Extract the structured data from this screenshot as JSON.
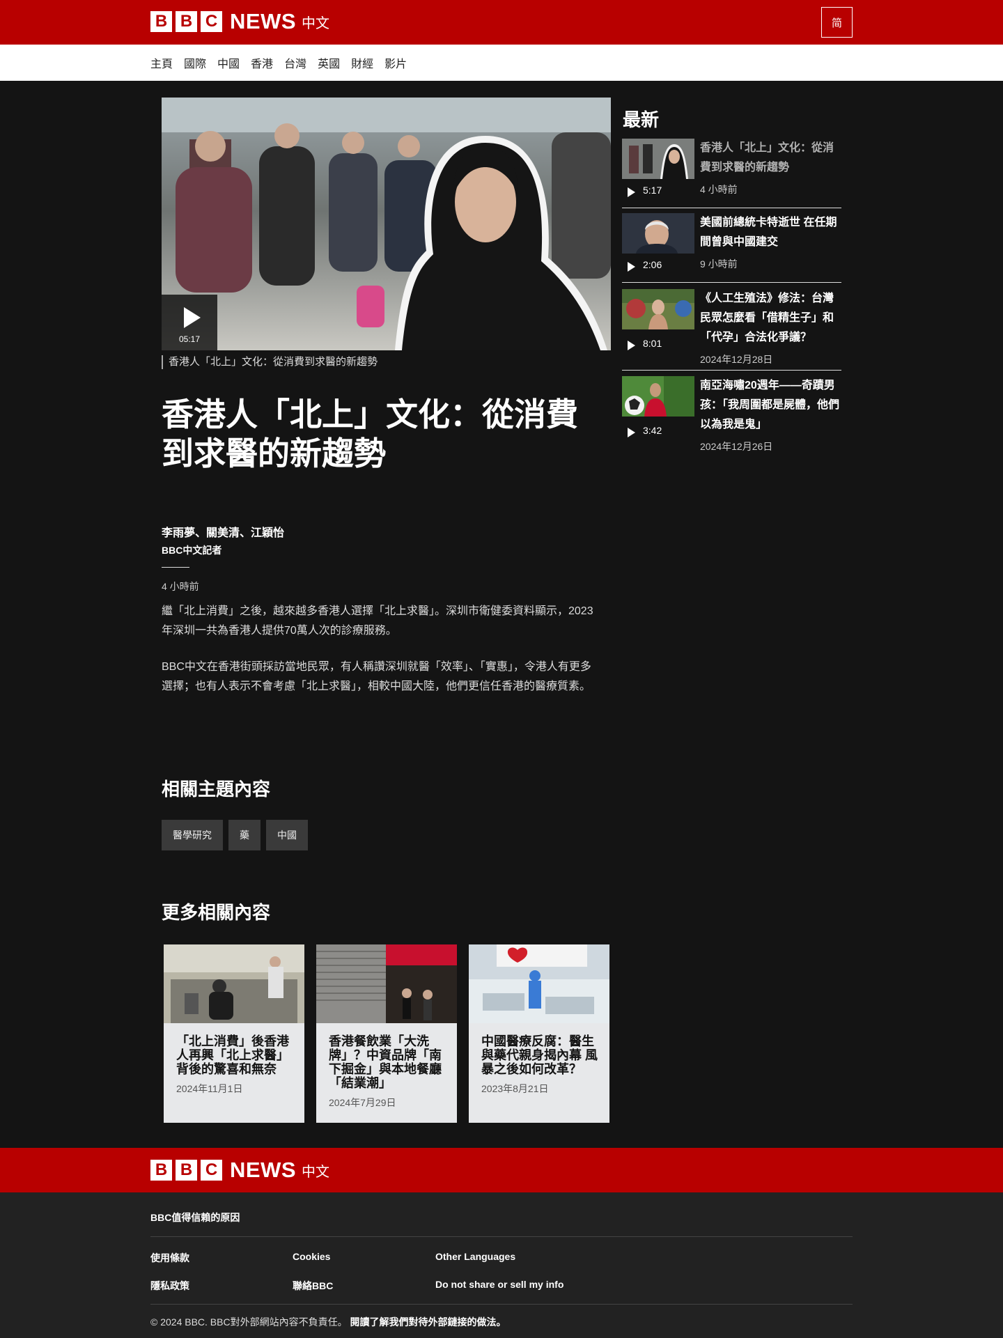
{
  "header": {
    "logo_letters": [
      "B",
      "B",
      "C"
    ],
    "logo_news": "NEWS",
    "logo_zh": "中文",
    "lang_toggle": "简"
  },
  "nav": [
    "主頁",
    "國際",
    "中國",
    "香港",
    "台灣",
    "英國",
    "財經",
    "影片"
  ],
  "hero": {
    "duration": "05:17",
    "caption": "香港人「北上」文化：從消費到求醫的新趨勢"
  },
  "article": {
    "headline": "香港人「北上」文化：從消費到求醫的新趨勢",
    "author": "李雨夢、關美清、江穎怡",
    "role": "BBC中文記者",
    "time": "4 小時前",
    "paragraphs": [
      "繼「北上消費」之後，越來越多香港人選擇「北上求醫」。深圳市衛健委資料顯示，2023年深圳一共為香港人提供70萬人次的診療服務。",
      "BBC中文在香港街頭採訪當地民眾，有人稱讚深圳就醫「效率」、「實惠」，令港人有更多選擇；也有人表示不會考慮「北上求醫」，相較中國大陸，他們更信任香港的醫療質素。"
    ]
  },
  "topics": {
    "heading": "相關主題內容",
    "tags": [
      "醫學研究",
      "藥",
      "中國"
    ]
  },
  "more": {
    "heading": "更多相關內容",
    "cards": [
      {
        "title": "「北上消費」後香港人再興「北上求醫」背後的驚喜和無奈",
        "date": "2024年11月1日"
      },
      {
        "title": "香港餐飲業「大洗牌」？中資品牌「南下掘金」與本地餐廳「結業潮」",
        "date": "2024年7月29日"
      },
      {
        "title": "中國醫療反腐：醫生與藥代親身揭內幕 風暴之後如何改革？",
        "date": "2023年8月21日"
      }
    ]
  },
  "sidebar": {
    "heading": "最新",
    "items": [
      {
        "title": "香港人「北上」文化：從消費到求醫的新趨勢",
        "duration": "5:17",
        "date": "4 小時前"
      },
      {
        "title": "美國前總統卡特逝世 在任期間曾與中國建交",
        "duration": "2:06",
        "date": "9 小時前"
      },
      {
        "title": "《人工生殖法》修法：台灣民眾怎麼看「借精生子」和「代孕」合法化爭議？",
        "duration": "8:01",
        "date": "2024年12月28日"
      },
      {
        "title": "南亞海嘯20週年——奇蹟男孩：「我周圍都是屍體，他們以為我是鬼」",
        "duration": "3:42",
        "date": "2024年12月26日"
      }
    ]
  },
  "footer": {
    "trust": "BBC值得信賴的原因",
    "links": [
      "使用條款",
      "Cookies",
      "Other Languages",
      "隱私政策",
      "聯絡BBC",
      "Do not share or sell my info"
    ],
    "copyright": "© 2024 BBC. BBC對外部網站內容不負責任。",
    "external_link": "閱讀了解我們對待外部鏈接的做法。"
  },
  "colors": {
    "brand_red": "#b80000",
    "page_bg": "#141414",
    "footer_bg": "#222222"
  }
}
